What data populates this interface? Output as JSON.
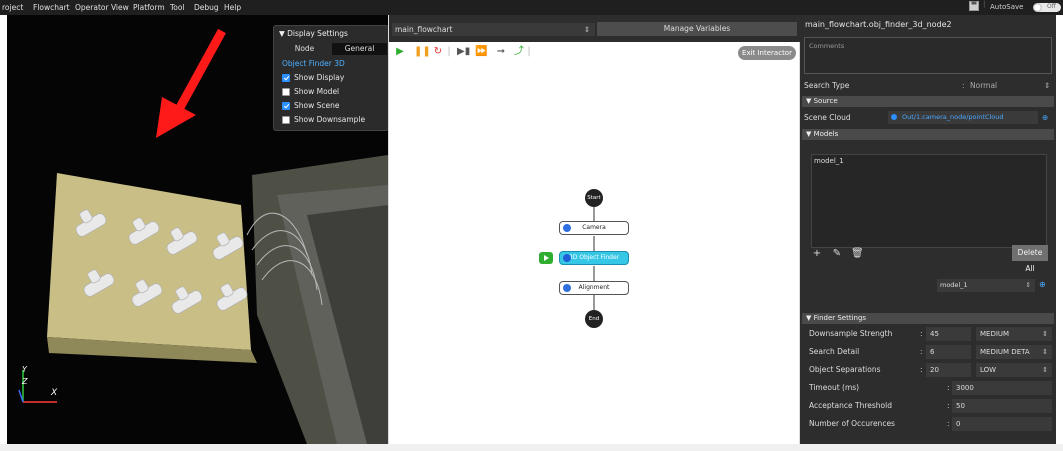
{
  "menu": {
    "items": [
      "roject",
      "Flowchart",
      "Operator View",
      "Platform",
      "Tool",
      "Debug",
      "Help"
    ],
    "autosave_label": "AutoSave",
    "toggle_label": "Off"
  },
  "viewer": {
    "display_settings": {
      "title": "Display Settings",
      "tabs": [
        "Node",
        "General"
      ],
      "section": "Object Finder 3D",
      "checkboxes": [
        {
          "label": "Show Display",
          "checked": true
        },
        {
          "label": "Show Model",
          "checked": false
        },
        {
          "label": "Show Scene",
          "checked": true
        },
        {
          "label": "Show Downsample",
          "checked": false
        }
      ]
    },
    "axes": {
      "y": "Y",
      "z": "Z",
      "x": "X"
    },
    "arrow_color": "#ff1a1a"
  },
  "flowchart": {
    "selected_flow": "main_flowchart",
    "manage_variables_label": "Manage Variables",
    "exit_interactor_label": "Exit Interactor",
    "nodes": {
      "start": "Start",
      "camera": "Camera",
      "object_finder": "3D Object Finder",
      "alignment": "Alignment",
      "end": "End"
    },
    "toolbar_icons": [
      "play-icon",
      "pause-icon",
      "restart-icon",
      "step-icon",
      "step-over-icon",
      "run-to-icon",
      "variables-icon"
    ]
  },
  "properties": {
    "title": "main_flowchart.obj_finder_3d_node2",
    "comments_placeholder": "Comments",
    "search_type": {
      "label": "Search Type",
      "value": "Normal"
    },
    "source": {
      "section": "Source",
      "scene_cloud_label": "Scene Cloud",
      "scene_cloud_value": "Out/1.camera_node/pointCloud"
    },
    "models": {
      "section": "Models",
      "items": [
        "model_1"
      ],
      "delete_all_label": "Delete All",
      "selected_model": "model_1"
    },
    "finder_settings": {
      "section": "Finder Settings",
      "rows": [
        {
          "label": "Downsample Strength",
          "value": "45",
          "level": "MEDIUM"
        },
        {
          "label": "Search Detail",
          "value": "6",
          "level": "MEDIUM DETA"
        },
        {
          "label": "Object Separations",
          "value": "20",
          "level": "LOW"
        },
        {
          "label": "Timeout (ms)",
          "value": "3000"
        },
        {
          "label": "Acceptance Threshold",
          "value": "50"
        },
        {
          "label": "Number of Occurences",
          "value": "0"
        }
      ]
    }
  }
}
